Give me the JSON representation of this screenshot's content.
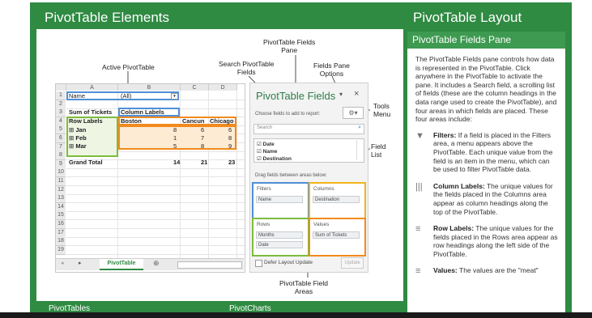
{
  "headers": {
    "left_title": "PivotTable Elements",
    "right_title": "PivotTable Layout",
    "right_subtitle": "PivotTable Fields Pane"
  },
  "callouts": {
    "active_pivot": "Active PivotTable",
    "fields_pane": "PivotTable Fields\nPane",
    "search_fields": "Search PivotTable\nFields",
    "pane_options": "Fields Pane\nOptions",
    "tools_menu": "Tools\nMenu",
    "field_list": "Field\nList",
    "field_areas": "PivotTable Field\nAreas"
  },
  "sheet": {
    "columns": [
      "A",
      "B",
      "C",
      "D"
    ],
    "rows": [
      "1",
      "2",
      "3",
      "4",
      "5",
      "6",
      "7",
      "8",
      "9",
      "10",
      "11",
      "12",
      "13",
      "14",
      "15",
      "16",
      "17",
      "18",
      "19"
    ],
    "filter_name": "Name",
    "filter_value": "(All)",
    "sum_label": "Sum of Tickets",
    "col_labels": "Column Labels",
    "row_labels": "Row Labels",
    "destinations": [
      "Boston",
      "Cancun",
      "Chicago"
    ],
    "months": [
      {
        "name": "Jan",
        "values": [
          "8",
          "6",
          "6"
        ]
      },
      {
        "name": "Feb",
        "values": [
          "1",
          "7",
          "8"
        ]
      },
      {
        "name": "Mar",
        "values": [
          "5",
          "8",
          "9"
        ]
      }
    ],
    "grand_total_label": "Grand Total",
    "grand_totals": [
      "14",
      "21",
      "23"
    ],
    "tab_name": "PivotTable",
    "add_sheet": "⊕"
  },
  "pane": {
    "title": "PivotTable Fields",
    "close": "×",
    "choose_text": "Choose fields to add to report:",
    "search_placeholder": "Search",
    "fields": [
      {
        "name": "Date",
        "checked": true
      },
      {
        "name": "Name",
        "checked": true
      },
      {
        "name": "Destination",
        "checked": true
      }
    ],
    "drag_text": "Drag fields between areas below:",
    "areas": {
      "filters_label": "Filters",
      "filters_item": "Name",
      "columns_label": "Columns",
      "columns_item": "Destination",
      "rows_label": "Rows",
      "rows_items": [
        "Months",
        "Date"
      ],
      "values_label": "Values",
      "values_item": "Sum of Tickets"
    },
    "defer_label": "Defer Layout Update",
    "update_label": "Update"
  },
  "right_panel": {
    "intro": "The PivotTable Fields pane controls how data is represented in the PivotTable. Click anywhere in the PivotTable to activate the pane. It includes a Search field, a scrolling list of fields (these are the column headings in the data range used to create the PivotTable), and four areas in which fields are placed. These four areas include:",
    "items": [
      {
        "icon": "filter-icon",
        "glyph": "▼",
        "title": "Filters:",
        "text": "If a field is placed in the Filters area, a menu appears above the PivotTable. Each unique value from the field is an item in the menu, which can be used to filter PivotTable data."
      },
      {
        "icon": "columns-icon",
        "glyph": "|||",
        "title": "Column Labels:",
        "text": "The unique values for the fields placed in the Columns area appear as column headings along the top of the PivotTable."
      },
      {
        "icon": "rows-icon",
        "glyph": "≡",
        "title": "Row Labels:",
        "text": "The unique values for the fields placed in the Rows area appear as row headings along the left side of the PivotTable."
      },
      {
        "icon": "values-icon",
        "glyph": "≡",
        "title": "Values:",
        "text": "The values are the \"meat\""
      }
    ]
  },
  "footer": {
    "left": "PivotTables",
    "right": "PivotCharts"
  },
  "colors": {
    "green": "#2f8a42",
    "blue_highlight": "#4f8fd6",
    "orange_highlight": "#f28a1d",
    "lime_highlight": "#7dbb3e"
  }
}
